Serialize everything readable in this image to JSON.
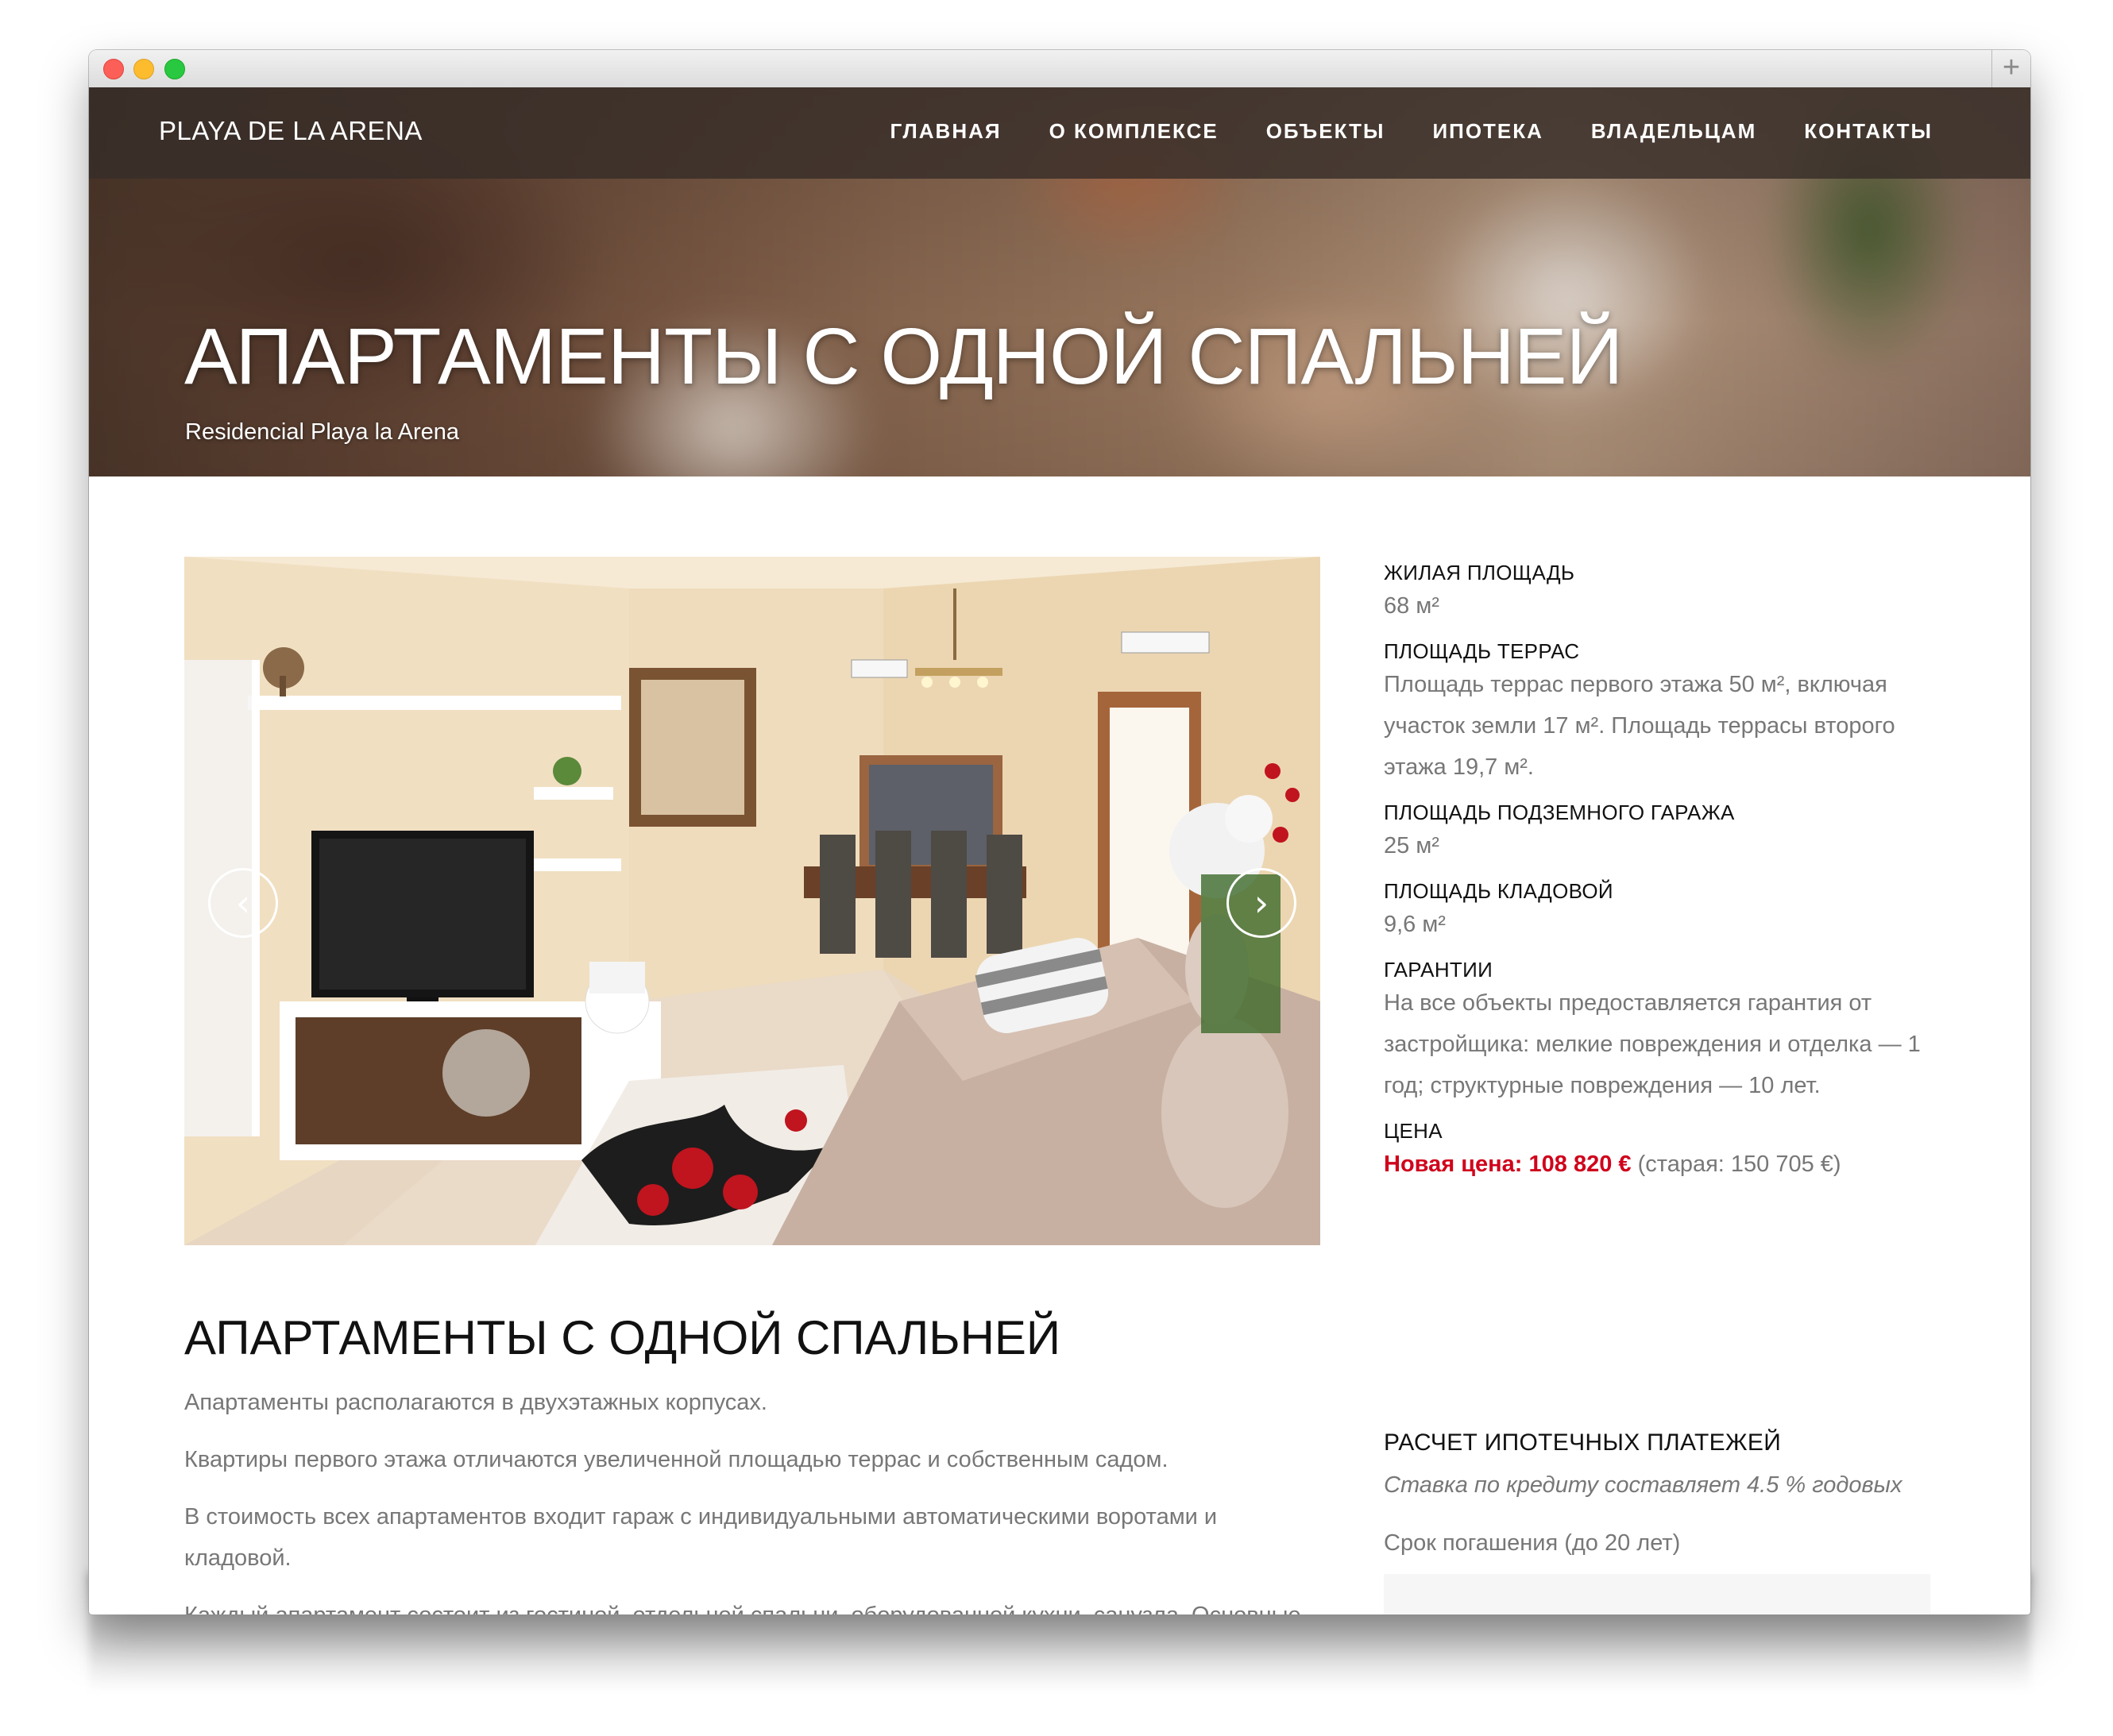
{
  "header": {
    "brand": "PLAYA DE LA ARENA",
    "nav": [
      "ГЛАВНАЯ",
      "О КОМПЛЕКСЕ",
      "ОБЪЕКТЫ",
      "ИПОТЕКА",
      "ВЛАДЕЛЬЦАМ",
      "КОНТАКТЫ"
    ]
  },
  "hero": {
    "title": "АПАРТАМЕНТЫ С ОДНОЙ СПАЛЬНЕЙ",
    "subtitle": "Residencial Playa la Arena"
  },
  "slider": {
    "prev_icon": "‹",
    "next_icon": "›"
  },
  "specs": [
    {
      "label": "ЖИЛАЯ ПЛОЩАДЬ",
      "value": "68 м²"
    },
    {
      "label": "ПЛОЩАДЬ ТЕРРАС",
      "value": "Площадь террас первого этажа 50 м², включая участок земли 17 м². Площадь террасы второго этажа 19,7 м²."
    },
    {
      "label": "ПЛОЩАДЬ ПОДЗЕМНОГО ГАРАЖА",
      "value": "25 м²"
    },
    {
      "label": "ПЛОЩАДЬ КЛАДОВОЙ",
      "value": "9,6 м²"
    },
    {
      "label": "ГАРАНТИИ",
      "value": "На все объекты предоставляется гарантия от застройщика: мелкие повреждения и отделка — 1 год; структурные повреждения — 10 лет."
    }
  ],
  "price": {
    "label": "ЦЕНА",
    "new": "Новая цена: 108 820 €",
    "old": " (старая: 150 705 €)"
  },
  "main": {
    "heading": "АПАРТАМЕНТЫ С ОДНОЙ СПАЛЬНЕЙ",
    "paragraphs": [
      "Апартаменты располагаются в двухэтажных корпусах.",
      "Квартиры первого этажа отличаются увеличенной площадью террас и собственным садом.",
      "В стоимость всех апартаментов входит гараж с индивидуальными автоматическими воротами и кладовой.",
      "Каждый апартамент состоит из гостиной, отдельной спальни, оборудованной кухни, санузла. Основные"
    ]
  },
  "mortgage": {
    "title": "РАСЧЕТ ИПОТЕЧНЫХ ПЛАТЕЖЕЙ",
    "rate": "Ставка по кредиту составляет 4.5 % годовых",
    "term_label": "Срок погашения (до 20 лет)"
  }
}
